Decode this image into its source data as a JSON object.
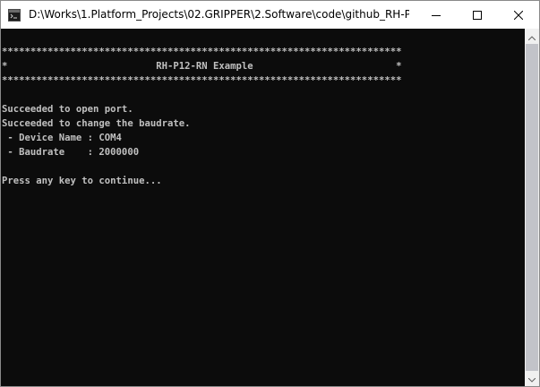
{
  "window": {
    "title": "D:\\Works\\1.Platform_Projects\\02.GRIPPER\\2.Software\\code\\github_RH-P1..."
  },
  "console": {
    "lines": [
      "**********************************************************************",
      "*                          RH-P12-RN Example                         *",
      "**********************************************************************",
      "",
      "Succeeded to open port.",
      "Succeeded to change the baudrate.",
      " - Device Name : COM4",
      " - Baudrate    : 2000000",
      "",
      "Press any key to continue..."
    ]
  },
  "icons": {
    "app": "console-app-icon",
    "minimize": "minimize-icon",
    "maximize": "maximize-icon",
    "close": "close-icon",
    "scroll_up": "scroll-up-arrow-icon",
    "scroll_down": "scroll-down-arrow-icon"
  },
  "colors": {
    "console_background": "#0c0c0c",
    "console_text": "#c0c0c0",
    "titlebar_background": "#ffffff",
    "scrollbar_track": "#f0f0f0",
    "scrollbar_thumb": "#c2c3c9"
  }
}
